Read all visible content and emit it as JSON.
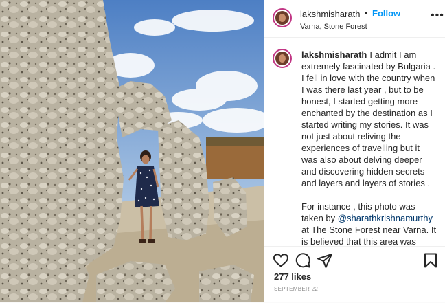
{
  "post": {
    "username": "lakshmisharath",
    "follow_label": "Follow",
    "location": "Varna, Stone Forest",
    "more_icon": "more-options-icon"
  },
  "caption": {
    "username": "lakshmisharath",
    "paragraph1": "I admit I am extremely fascinated by Bulgaria . I fell in love with the country when I was there last year , but to be honest, I started getting more enchanted by the destination as I started writing my stories. It was not just about reliving the experiences of travelling but it was also about delving deeper and discovering hidden secrets and layers and layers of stories .",
    "paragraph2_before": "For instance , this photo was taken by ",
    "mention": "@sharathkrishnamurthy",
    "paragraph2_after": " at The Stone Forest near Varna. It is believed that this area was under the ocean and the bed was filled with earth pillars , which would have been created millions of years ago. While there are no concrete theories behind their"
  },
  "engagement": {
    "likes": "277 likes",
    "date": "SEPTEMBER 22"
  },
  "icons": [
    "heart-icon",
    "comment-icon",
    "share-icon",
    "bookmark-icon"
  ],
  "colors": {
    "link": "#0095f6",
    "text": "#262626",
    "muted": "#8e8e8e"
  }
}
